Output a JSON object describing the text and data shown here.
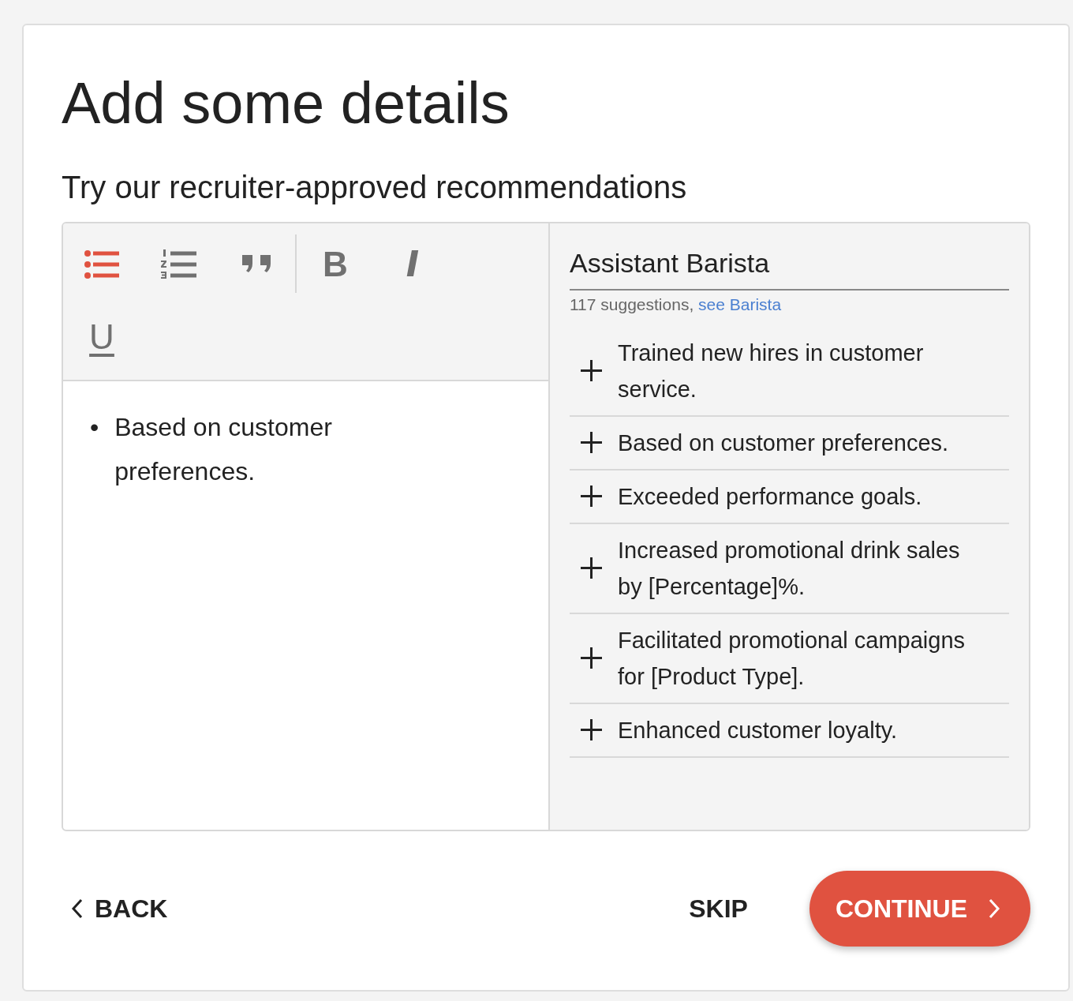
{
  "title": "Add some details",
  "subtitle": "Try our recruiter-approved recommendations",
  "toolbar": [
    {
      "kind": "bullet-list",
      "selected": true
    },
    {
      "kind": "numbered-list",
      "selected": false
    },
    {
      "kind": "quote",
      "selected": false
    },
    {
      "kind": "divider"
    },
    {
      "kind": "bold",
      "glyph": "B",
      "selected": false
    },
    {
      "kind": "italic",
      "glyph": "I",
      "selected": false
    },
    {
      "kind": "underline",
      "glyph": "U",
      "selected": false
    }
  ],
  "editor": {
    "marker": "•",
    "bullets": [
      "Based on customer preferences."
    ]
  },
  "suggestions": {
    "job_title": "Assistant Barista",
    "count": "117 suggestions,",
    "link": "see Barista",
    "items": [
      "Trained new hires in customer service.",
      "Based on customer preferences.",
      "Exceeded performance goals.",
      "Increased promotional drink sales by [Percentage]%.",
      "Facilitated promotional campaigns for [Product Type].",
      "Enhanced customer loyalty."
    ]
  },
  "footer": {
    "back": "BACK",
    "skip": "SKIP",
    "continue": "CONTINUE"
  }
}
